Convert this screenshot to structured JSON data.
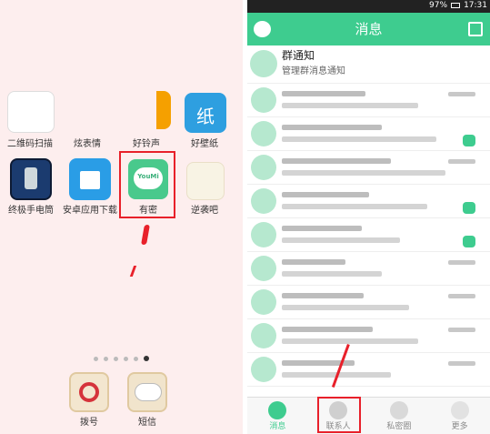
{
  "home": {
    "apps_row1": [
      {
        "label": "二维码扫描",
        "icon": "qr-scanner-icon"
      },
      {
        "label": "炫表情",
        "icon": "emoji-icon"
      },
      {
        "label": "好铃声",
        "icon": "ringtone-icon"
      },
      {
        "label": "好壁纸",
        "icon": "wallpaper-icon",
        "glyph": "纸"
      }
    ],
    "apps_row2": [
      {
        "label": "终极手电筒",
        "icon": "flashlight-icon"
      },
      {
        "label": "安卓应用下载",
        "icon": "shopping-bag-icon"
      },
      {
        "label": "有密",
        "icon": "youmi-chat-icon",
        "glyph": "YouMi"
      },
      {
        "label": "逆袭吧",
        "icon": "nixiba-icon"
      }
    ],
    "dock": [
      {
        "label": "拨号",
        "icon": "phone-dial-icon"
      },
      {
        "label": "短信",
        "icon": "sms-icon"
      }
    ],
    "page_dots": 6,
    "active_dot": 5
  },
  "phone": {
    "status": {
      "battery": "97%",
      "time": "17:31"
    },
    "header": {
      "title": "消息"
    },
    "group_notice": {
      "title": "群通知",
      "subtitle": "管理群消息通知"
    },
    "tabs": [
      {
        "label": "消息",
        "icon": "chat-bubble-icon",
        "active": true
      },
      {
        "label": "联系人",
        "icon": "contacts-icon",
        "active": false
      },
      {
        "label": "私密圈",
        "icon": "eye-icon",
        "active": false
      },
      {
        "label": "更多",
        "icon": "more-icon",
        "active": false
      }
    ]
  },
  "colors": {
    "accent": "#3ecc8f",
    "highlight": "#e8202a"
  }
}
